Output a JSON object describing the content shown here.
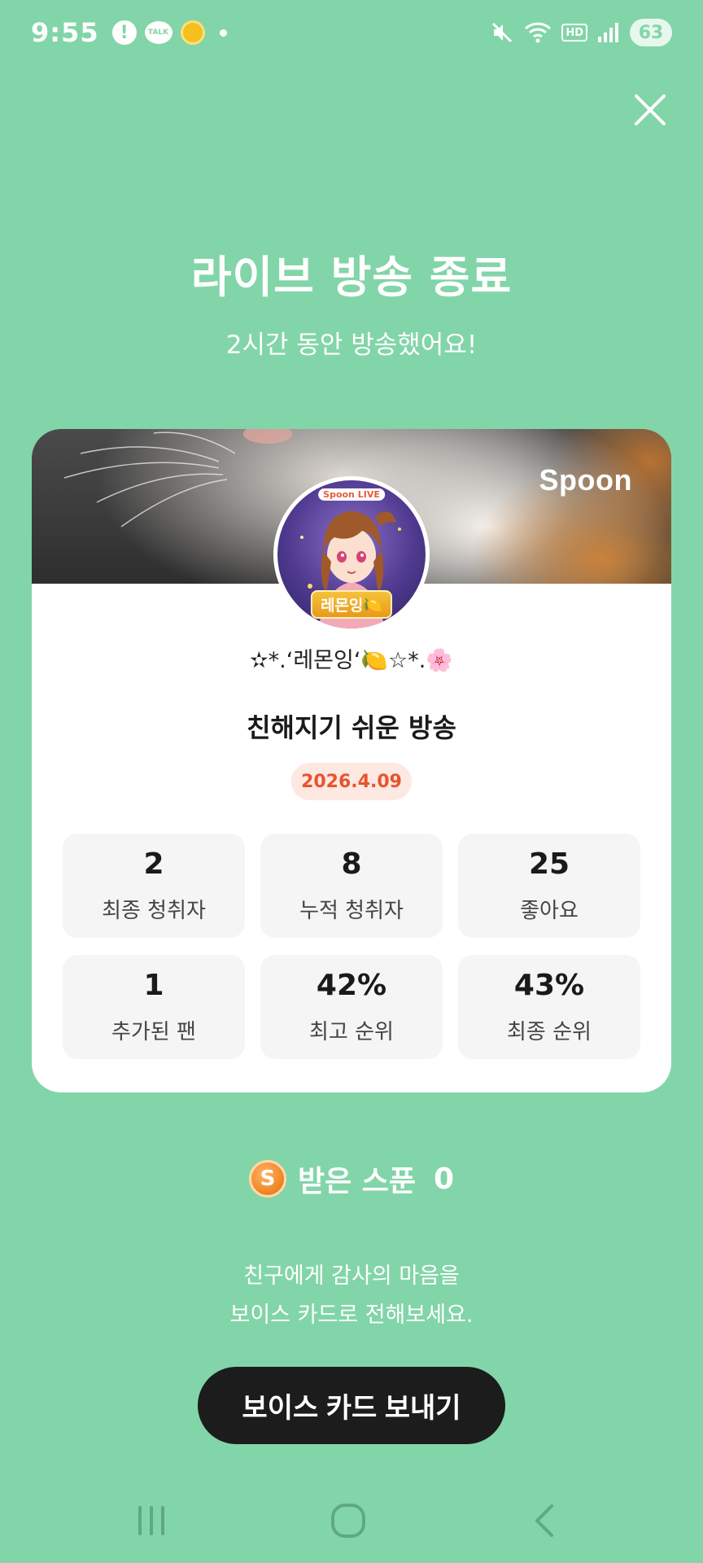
{
  "status_bar": {
    "time": "9:55",
    "alert_icon_text": "!",
    "talk_icon_text": "TALK",
    "hd_label": "HD",
    "battery": "63"
  },
  "header": {
    "title": "라이브 방송 종료",
    "subtitle": "2시간 동안 방송했어요!"
  },
  "card": {
    "brand": "Spoon",
    "avatar_tag": "Spoon LIVE",
    "avatar_name": "레몬잉🍋",
    "nickname": "✫*.ʻ레몬잉ʻ🍋☆*.🌸",
    "room_title": "친해지기 쉬운 방송",
    "date": "2026.4.09",
    "stats": [
      {
        "value": "2",
        "label": "최종 청취자"
      },
      {
        "value": "8",
        "label": "누적 청취자"
      },
      {
        "value": "25",
        "label": "좋아요"
      },
      {
        "value": "1",
        "label": "추가된 팬"
      },
      {
        "value": "42%",
        "label": "최고 순위"
      },
      {
        "value": "43%",
        "label": "최종 순위"
      }
    ]
  },
  "spoons": {
    "coin_symbol": "S",
    "label": "받은 스푼",
    "count": "0"
  },
  "message": {
    "line1": "친구에게 감사의 마음을",
    "line2": "보이스 카드로 전해보세요."
  },
  "send_button_label": "보이스 카드 보내기"
}
